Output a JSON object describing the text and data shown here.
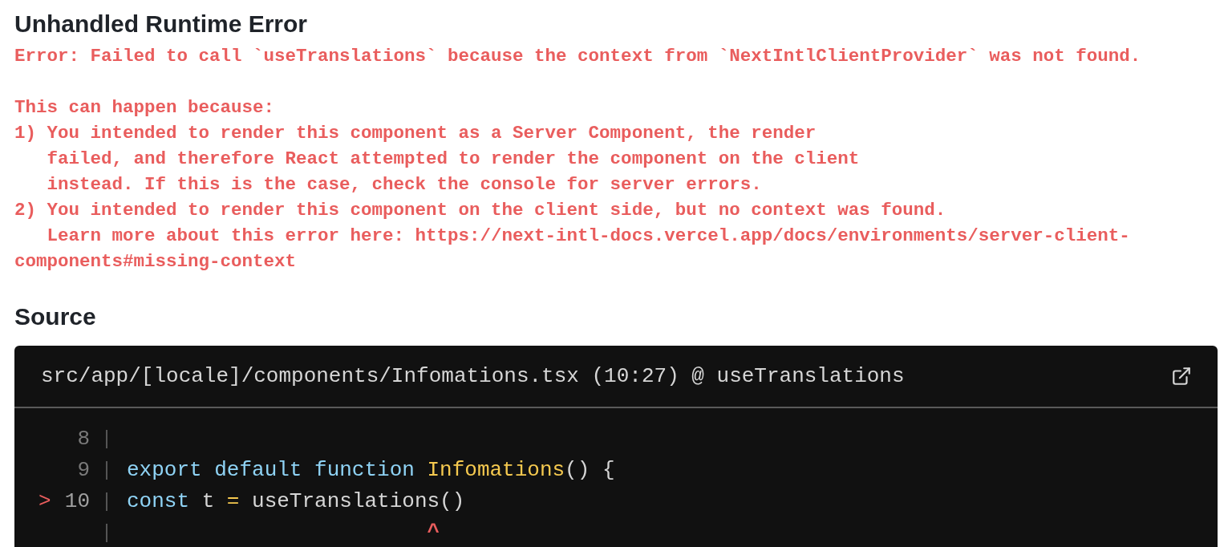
{
  "title": "Unhandled Runtime Error",
  "error_message": [
    [
      "Error: Failed to call `useTranslations` because the context from `NextIntlClientProvider` was not found."
    ],
    [
      "This can happen because:",
      "1) You intended to render this component as a Server Component, the render",
      "   failed, and therefore React attempted to render the component on the client",
      "   instead. If this is the case, check the console for server errors.",
      "2) You intended to render this component on the client side, but no context was found.",
      "   Learn more about this error here: https://next-intl-docs.vercel.app/docs/environments/server-client-",
      "components#missing-context"
    ]
  ],
  "source": {
    "heading": "Source",
    "file": "src/app/[locale]/components/Infomations.tsx (10:27) @ useTranslations",
    "lines": [
      {
        "kind": "code",
        "number": "8",
        "highlighted": false
      },
      {
        "kind": "code",
        "number": "9",
        "highlighted": false,
        "tokens": [
          {
            "kind": "keyword",
            "text": "export default function "
          },
          {
            "kind": "function",
            "text": "Infomations"
          },
          {
            "kind": "plain",
            "text": "() {"
          }
        ]
      },
      {
        "kind": "code",
        "number": "10",
        "highlighted": true,
        "marker": ">",
        "tokens": [
          {
            "kind": "keyword",
            "text": "const "
          },
          {
            "kind": "plain",
            "text": "t "
          },
          {
            "kind": "operator",
            "text": "= "
          },
          {
            "kind": "plain",
            "text": "useTranslations()"
          }
        ]
      },
      {
        "kind": "caret",
        "text": "                        ^"
      }
    ]
  }
}
